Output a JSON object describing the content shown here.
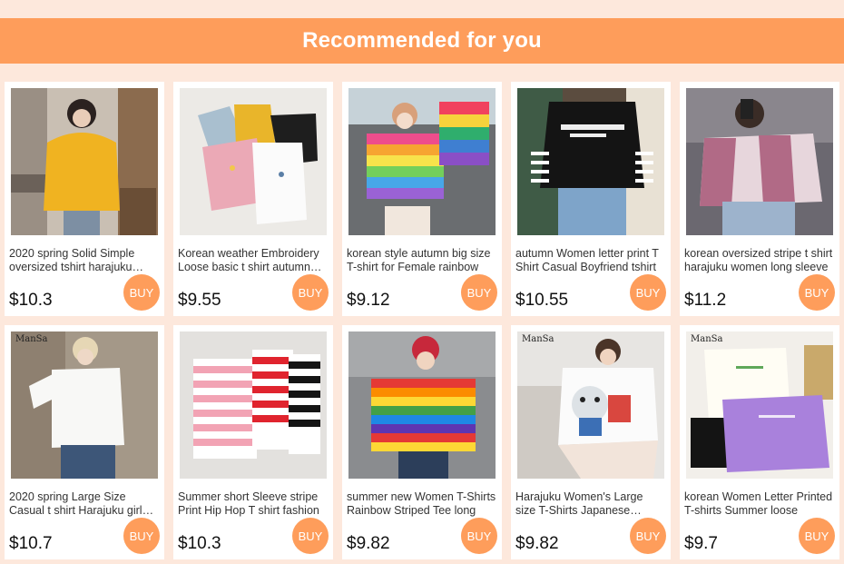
{
  "header": {
    "title": "Recommended for you"
  },
  "products": [
    {
      "name": "2020 spring Solid Simple oversized tshirt harajuku women",
      "price": "$10.3",
      "buy_label": "BUY",
      "image": "woman-yellow-tshirt"
    },
    {
      "name": "Korean weather Embroidery Loose basic t shirt autumn women",
      "price": "$9.55",
      "buy_label": "BUY",
      "image": "pastel-tshirts-flatlay"
    },
    {
      "name": "korean style autumn big size T-shirt for Female rainbow",
      "price": "$9.12",
      "buy_label": "BUY",
      "image": "rainbow-stripe-sweater"
    },
    {
      "name": "autumn Women letter print T Shirt Casual Boyfriend tshirt",
      "price": "$10.55",
      "buy_label": "BUY",
      "image": "black-letter-tshirt"
    },
    {
      "name": "korean oversized stripe t shirt harajuku women long sleeve",
      "price": "$11.2",
      "buy_label": "BUY",
      "image": "pink-plaid-shirt"
    },
    {
      "name": "2020 spring Large Size Casual t shirt Harajuku girl loose",
      "price": "$10.7",
      "buy_label": "BUY",
      "image": "woman-white-longsleeve",
      "watermark": "ManSa"
    },
    {
      "name": "Summer short Sleeve stripe Print Hip Hop T shirt fashion",
      "price": "$10.3",
      "buy_label": "BUY",
      "image": "striped-tshirts-rack"
    },
    {
      "name": "summer new Women T-Shirts Rainbow Striped Tee long",
      "price": "$9.82",
      "buy_label": "BUY",
      "image": "woman-rainbow-stripes"
    },
    {
      "name": "Harajuku Women's Large size T-Shirts Japanese cartoon",
      "price": "$9.82",
      "buy_label": "BUY",
      "image": "cartoon-cat-tshirt",
      "watermark": "ManSa"
    },
    {
      "name": "korean Women Letter Printed T-shirts Summer loose",
      "price": "$9.7",
      "buy_label": "BUY",
      "image": "purple-letter-tshirt",
      "watermark": "ManSa"
    }
  ],
  "colors": {
    "accent": "#fe9d5b",
    "background": "#fde8dc",
    "card": "#ffffff"
  }
}
